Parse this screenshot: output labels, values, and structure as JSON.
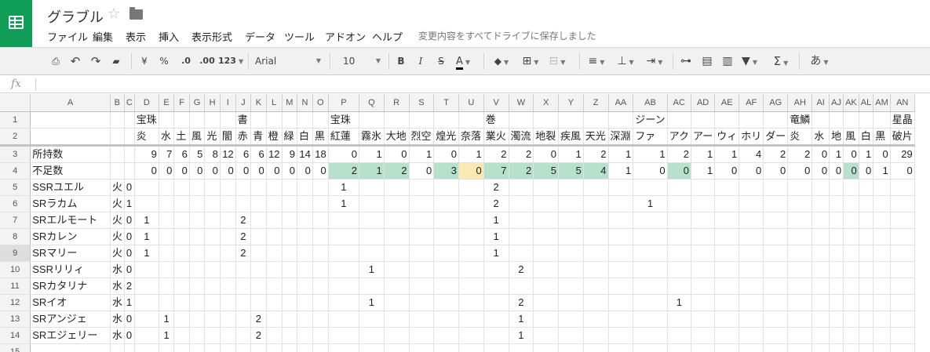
{
  "app": {
    "doc_title": "グラブル",
    "save_status": "変更内容をすべてドライブに保存しました",
    "menu": [
      "ファイル",
      "編集",
      "表示",
      "挿入",
      "表示形式",
      "データ",
      "ツール",
      "アドオン",
      "ヘルプ"
    ]
  },
  "toolbar": {
    "currency": "¥",
    "percent": "%",
    "dec_decrease": ".0",
    "dec_increase": ".00",
    "format_more": "123",
    "font": "Arial",
    "font_size": "10",
    "bold": "B",
    "italic": "I",
    "strike": "S",
    "text_color": "A",
    "ime": "あ",
    "text_color_hex": "#000000"
  },
  "formula": {
    "fx": "fx",
    "value": ""
  },
  "colors": {
    "green": "#b7e1cd",
    "orange": "#fce8b2"
  },
  "columns": [
    "A",
    "B",
    "C",
    "D",
    "E",
    "F",
    "G",
    "H",
    "I",
    "J",
    "K",
    "L",
    "M",
    "N",
    "O",
    "P",
    "Q",
    "R",
    "S",
    "T",
    "U",
    "V",
    "W",
    "X",
    "Y",
    "Z",
    "AA",
    "AB",
    "AC",
    "AD",
    "AE",
    "AF",
    "AG",
    "AH",
    "AI",
    "AJ",
    "AK",
    "AL",
    "AM",
    "AN"
  ],
  "rows": [
    {
      "n": "1",
      "c": [
        "",
        "",
        "",
        "宝珠",
        "",
        "",
        "",
        "",
        "",
        "書",
        "",
        "",
        "",
        "",
        "",
        "宝珠",
        "",
        "",
        "",
        "",
        "",
        "巻",
        "",
        "",
        "",
        "",
        "",
        "ジーン",
        "",
        "",
        "",
        "",
        "",
        "竜鱗",
        "",
        "",
        "",
        "",
        "",
        "星晶"
      ]
    },
    {
      "n": "2",
      "c": [
        "",
        "",
        "",
        "炎",
        "水",
        "土",
        "風",
        "光",
        "闇",
        "赤",
        "青",
        "橙",
        "緑",
        "白",
        "黒",
        "紅蓮",
        "霧氷",
        "大地",
        "烈空",
        "煌光",
        "奈落",
        "業火",
        "濁流",
        "地裂",
        "疾風",
        "天光",
        "深淵",
        "ファ",
        "アク",
        "アー",
        "ウィ",
        "ホリ",
        "ダー",
        "炎",
        "水",
        "地",
        "風",
        "白",
        "黒",
        "破片"
      ]
    },
    {
      "n": "3",
      "c": [
        "所持数",
        "",
        "",
        "9",
        "7",
        "6",
        "5",
        "8",
        "12",
        "6",
        "6",
        "12",
        "9",
        "14",
        "18",
        "0",
        "1",
        "0",
        "1",
        "0",
        "1",
        "2",
        "2",
        "0",
        "1",
        "2",
        "1",
        "1",
        "2",
        "1",
        "1",
        "4",
        "2",
        "2",
        "0",
        "1",
        "0",
        "1",
        "0",
        "29"
      ]
    },
    {
      "n": "4",
      "c": [
        "不足数",
        "",
        "",
        "0",
        "0",
        "0",
        "0",
        "0",
        "0",
        "0",
        "0",
        "0",
        "0",
        "0",
        "0",
        "2",
        "1",
        "2",
        "0",
        "3",
        "0",
        "7",
        "2",
        "5",
        "5",
        "4",
        "1",
        "0",
        "0",
        "1",
        "0",
        "0",
        "0",
        "0",
        "0",
        "0",
        "0",
        "0",
        "1",
        "0"
      ]
    },
    {
      "n": "5",
      "c": [
        "SSRユエル",
        "火",
        "0",
        "",
        "",
        "",
        "",
        "",
        "",
        "",
        "",
        "",
        "",
        "",
        "",
        "1",
        "",
        "",
        "",
        "",
        "",
        "2",
        "",
        "",
        "",
        "",
        "",
        "",
        "",
        "",
        "",
        "",
        "",
        "",
        "",
        "",
        "",
        "",
        "",
        ""
      ]
    },
    {
      "n": "6",
      "c": [
        "SRラカム",
        "火",
        "1",
        "",
        "",
        "",
        "",
        "",
        "",
        "",
        "",
        "",
        "",
        "",
        "",
        "1",
        "",
        "",
        "",
        "",
        "",
        "2",
        "",
        "",
        "",
        "",
        "",
        "1",
        "",
        "",
        "",
        "",
        "",
        "",
        "",
        "",
        "",
        "",
        "",
        ""
      ]
    },
    {
      "n": "7",
      "c": [
        "SRエルモート",
        "火",
        "0",
        "1",
        "",
        "",
        "",
        "",
        "",
        "2",
        "",
        "",
        "",
        "",
        "",
        "",
        "",
        "",
        "",
        "",
        "",
        "1",
        "",
        "",
        "",
        "",
        "",
        "",
        "",
        "",
        "",
        "",
        "",
        "",
        "",
        "",
        "",
        "",
        "",
        ""
      ]
    },
    {
      "n": "8",
      "c": [
        "SRカレン",
        "火",
        "0",
        "1",
        "",
        "",
        "",
        "",
        "",
        "2",
        "",
        "",
        "",
        "",
        "",
        "",
        "",
        "",
        "",
        "",
        "",
        "1",
        "",
        "",
        "",
        "",
        "",
        "",
        "",
        "",
        "",
        "",
        "",
        "",
        "",
        "",
        "",
        "",
        "",
        ""
      ]
    },
    {
      "n": "9",
      "c": [
        "SRマリー",
        "火",
        "0",
        "1",
        "",
        "",
        "",
        "",
        "",
        "2",
        "",
        "",
        "",
        "",
        "",
        "",
        "",
        "",
        "",
        "",
        "",
        "1",
        "",
        "",
        "",
        "",
        "",
        "",
        "",
        "",
        "",
        "",
        "",
        "",
        "",
        "",
        "",
        "",
        "",
        ""
      ]
    },
    {
      "n": "10",
      "c": [
        "SSRリリィ",
        "水",
        "0",
        "",
        "",
        "",
        "",
        "",
        "",
        "",
        "",
        "",
        "",
        "",
        "",
        "",
        "1",
        "",
        "",
        "",
        "",
        "",
        "2",
        "",
        "",
        "",
        "",
        "",
        "",
        "",
        "",
        "",
        "",
        "",
        "",
        "",
        "",
        "",
        "",
        ""
      ]
    },
    {
      "n": "11",
      "c": [
        "SRカタリナ",
        "水",
        "2",
        "",
        "",
        "",
        "",
        "",
        "",
        "",
        "",
        "",
        "",
        "",
        "",
        "",
        "",
        "",
        "",
        "",
        "",
        "",
        "",
        "",
        "",
        "",
        "",
        "",
        "",
        "",
        "",
        "",
        "",
        "",
        "",
        "",
        "",
        "",
        "",
        ""
      ]
    },
    {
      "n": "12",
      "c": [
        "SRイオ",
        "水",
        "1",
        "",
        "",
        "",
        "",
        "",
        "",
        "",
        "",
        "",
        "",
        "",
        "",
        "",
        "1",
        "",
        "",
        "",
        "",
        "",
        "2",
        "",
        "",
        "",
        "",
        "",
        "1",
        "",
        "",
        "",
        "",
        "",
        "",
        "",
        "",
        "",
        "",
        ""
      ]
    },
    {
      "n": "13",
      "c": [
        "SRアンジェ",
        "水",
        "0",
        "",
        "1",
        "",
        "",
        "",
        "",
        "",
        "2",
        "",
        "",
        "",
        "",
        "",
        "",
        "",
        "",
        "",
        "",
        "",
        "1",
        "",
        "",
        "",
        "",
        "",
        "",
        "",
        "",
        "",
        "",
        "",
        "",
        "",
        "",
        "",
        "",
        ""
      ]
    },
    {
      "n": "14",
      "c": [
        "SRエジェリー",
        "水",
        "0",
        "",
        "1",
        "",
        "",
        "",
        "",
        "",
        "2",
        "",
        "",
        "",
        "",
        "",
        "",
        "",
        "",
        "",
        "",
        "",
        "1",
        "",
        "",
        "",
        "",
        "",
        "",
        "",
        "",
        "",
        "",
        "",
        "",
        "",
        "",
        "",
        "",
        ""
      ]
    },
    {
      "n": "15",
      "c": [
        "",
        "",
        "",
        "",
        "",
        "",
        "",
        "",
        "",
        "",
        "",
        "",
        "",
        "",
        "",
        "",
        "",
        "",
        "",
        "",
        "",
        "",
        "",
        "",
        "",
        "",
        "",
        "",
        "",
        "",
        "",
        "",
        "",
        "",
        "",
        "",
        "",
        "",
        "",
        ""
      ]
    }
  ]
}
